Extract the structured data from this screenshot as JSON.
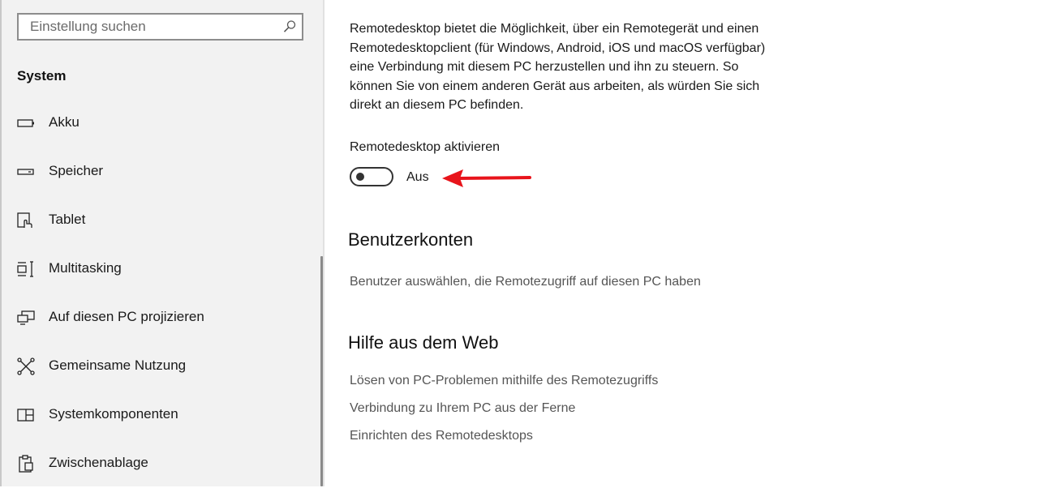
{
  "sidebar": {
    "search": {
      "placeholder": "Einstellung suchen",
      "icon": "search-icon"
    },
    "section_title": "System",
    "items": [
      {
        "label": "Akku",
        "icon": "battery-icon"
      },
      {
        "label": "Speicher",
        "icon": "storage-icon"
      },
      {
        "label": "Tablet",
        "icon": "tablet-icon"
      },
      {
        "label": "Multitasking",
        "icon": "multitasking-icon"
      },
      {
        "label": "Auf diesen PC projizieren",
        "icon": "projection-icon"
      },
      {
        "label": "Gemeinsame Nutzung",
        "icon": "shared-experiences-icon"
      },
      {
        "label": "Systemkomponenten",
        "icon": "system-components-icon"
      },
      {
        "label": "Zwischenablage",
        "icon": "clipboard-icon"
      }
    ]
  },
  "main": {
    "description_lines": [
      "Remotedesktop bietet die Möglichkeit, über ein Remotegerät und einen",
      "Remotedesktopclient (für Windows, Android, iOS und macOS verfügbar)",
      "eine Verbindung mit diesem PC herzustellen und ihn zu steuern. So",
      "können Sie von einem anderen Gerät aus arbeiten, als würden Sie sich",
      "direkt an diesem PC befinden."
    ],
    "toggle": {
      "label": "Remotedesktop aktivieren",
      "state": "Aus",
      "on": false
    },
    "annotation_arrow_color": "#e8141b",
    "accounts": {
      "heading": "Benutzerkonten",
      "link": "Benutzer auswählen, die Remotezugriff auf diesen PC haben"
    },
    "help": {
      "heading": "Hilfe aus dem Web",
      "links": [
        "Lösen von PC-Problemen mithilfe des Remotezugriffs",
        "Verbindung zu Ihrem PC aus der Ferne",
        "Einrichten des Remotedesktops"
      ]
    }
  }
}
